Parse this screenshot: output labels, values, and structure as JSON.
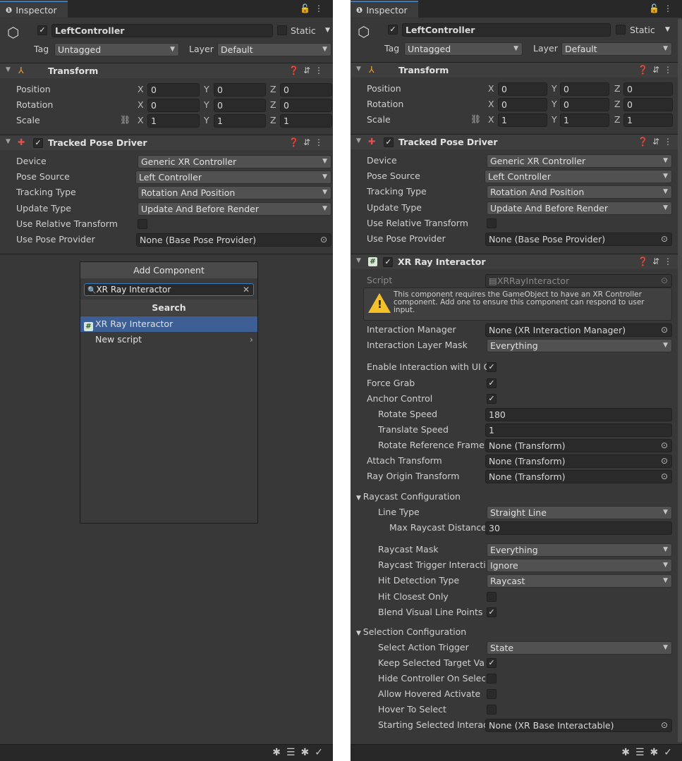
{
  "left": {
    "tab": {
      "label": "Inspector"
    },
    "object": {
      "name": "LeftController",
      "active": true,
      "static_label": "Static",
      "tag_label": "Tag",
      "tag_value": "Untagged",
      "layer_label": "Layer",
      "layer_value": "Default"
    },
    "transform": {
      "title": "Transform",
      "rows": [
        {
          "label": "Position",
          "x": "0",
          "y": "0",
          "z": "0"
        },
        {
          "label": "Rotation",
          "x": "0",
          "y": "0",
          "z": "0"
        },
        {
          "label": "Scale",
          "x": "1",
          "y": "1",
          "z": "1"
        }
      ]
    },
    "pose_driver": {
      "title": "Tracked Pose Driver",
      "device_label": "Device",
      "device_value": "Generic XR Controller",
      "pose_source_label": "Pose Source",
      "pose_source_value": "Left Controller",
      "tracking_type_label": "Tracking Type",
      "tracking_type_value": "Rotation And Position",
      "update_type_label": "Update Type",
      "update_type_value": "Update And Before Render",
      "use_relative_label": "Use Relative Transform",
      "use_pose_provider_label": "Use Pose Provider",
      "use_pose_provider_value": "None (Base Pose Provider)"
    },
    "popup": {
      "header": "Add Component",
      "search_text": "XR Ray Interactor",
      "section_title": "Search",
      "item1": "XR Ray Interactor",
      "item2": "New script"
    }
  },
  "right": {
    "tab": {
      "label": "Inspector"
    },
    "object": {
      "name": "LeftController",
      "static_label": "Static",
      "tag_label": "Tag",
      "tag_value": "Untagged",
      "layer_label": "Layer",
      "layer_value": "Default"
    },
    "transform": {
      "title": "Transform",
      "rows": [
        {
          "label": "Position",
          "x": "0",
          "y": "0",
          "z": "0"
        },
        {
          "label": "Rotation",
          "x": "0",
          "y": "0",
          "z": "0"
        },
        {
          "label": "Scale",
          "x": "1",
          "y": "1",
          "z": "1"
        }
      ]
    },
    "pose_driver": {
      "title": "Tracked Pose Driver",
      "device_label": "Device",
      "device_value": "Generic XR Controller",
      "pose_source_label": "Pose Source",
      "pose_source_value": "Left Controller",
      "tracking_type_label": "Tracking Type",
      "tracking_type_value": "Rotation And Position",
      "update_type_label": "Update Type",
      "update_type_value": "Update And Before Render",
      "use_relative_label": "Use Relative Transform",
      "use_pose_provider_label": "Use Pose Provider",
      "use_pose_provider_value": "None (Base Pose Provider)"
    },
    "ray_interactor": {
      "title": "XR Ray Interactor",
      "script_label": "Script",
      "script_value": "XRRayInteractor",
      "warning": "This component requires the GameObject to have an XR Controller component. Add one to ensure this component can respond to user input.",
      "interaction_manager_label": "Interaction Manager",
      "interaction_manager_value": "None (XR Interaction Manager)",
      "interaction_layer_label": "Interaction Layer Mask",
      "interaction_layer_value": "Everything",
      "enable_ui_label": "Enable Interaction with UI G",
      "force_grab_label": "Force Grab",
      "anchor_control_label": "Anchor Control",
      "rotate_speed_label": "Rotate Speed",
      "rotate_speed_value": "180",
      "translate_speed_label": "Translate Speed",
      "translate_speed_value": "1",
      "rotate_ref_label": "Rotate Reference Frame",
      "rotate_ref_value": "None (Transform)",
      "attach_label": "Attach Transform",
      "attach_value": "None (Transform)",
      "ray_origin_label": "Ray Origin Transform",
      "ray_origin_value": "None (Transform)",
      "raycast_config_label": "Raycast Configuration",
      "line_type_label": "Line Type",
      "line_type_value": "Straight Line",
      "max_distance_label": "Max Raycast Distance",
      "max_distance_value": "30",
      "raycast_mask_label": "Raycast Mask",
      "raycast_mask_value": "Everything",
      "trigger_label": "Raycast Trigger Interacti",
      "trigger_value": "Ignore",
      "hit_detection_label": "Hit Detection Type",
      "hit_detection_value": "Raycast",
      "hit_closest_label": "Hit Closest Only",
      "blend_label": "Blend Visual Line Points",
      "selection_config_label": "Selection Configuration",
      "select_trigger_label": "Select Action Trigger",
      "select_trigger_value": "State",
      "keep_selected_label": "Keep Selected Target Va",
      "hide_controller_label": "Hide Controller On Selec",
      "allow_hovered_label": "Allow Hovered Activate",
      "hover_to_select_label": "Hover To Select",
      "starting_selected_label": "Starting Selected Interac",
      "starting_selected_value": "None (XR Base Interactable)"
    }
  }
}
